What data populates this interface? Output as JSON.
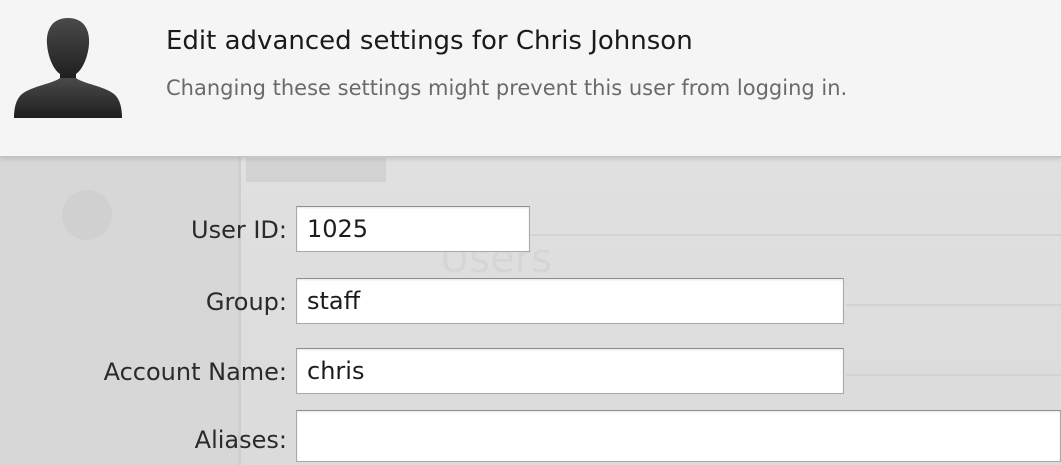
{
  "header": {
    "title": "Edit advanced settings for Chris Johnson",
    "subtitle": "Changing these settings might prevent this user from logging in.",
    "avatar_icon": "user-silhouette-icon"
  },
  "background": {
    "ghost_text": "Users"
  },
  "form": {
    "user_id": {
      "label": "User ID:",
      "value": "1025"
    },
    "group": {
      "label": "Group:",
      "value": "staff"
    },
    "account_name": {
      "label": "Account Name:",
      "value": "chris"
    },
    "aliases": {
      "label": "Aliases:",
      "value": ""
    }
  }
}
